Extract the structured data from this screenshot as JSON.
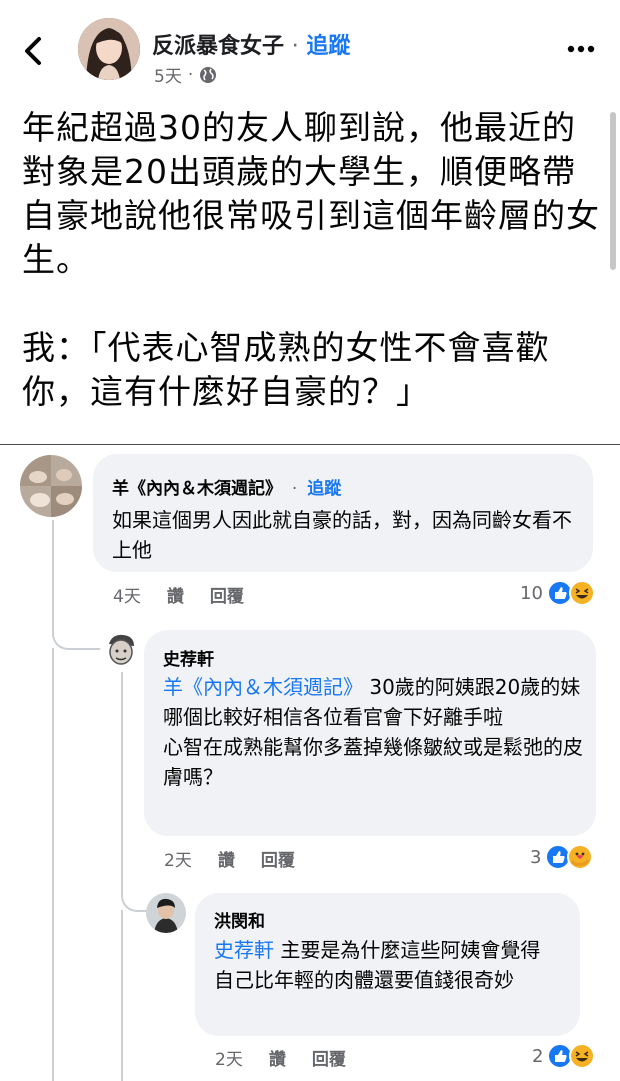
{
  "post": {
    "author": "反派暴食女子",
    "follow_label": "追蹤",
    "time": "5天",
    "separator": "·",
    "body": "年紀超過30的友人聊到說，他最近的對象是20出頭歲的大學生，順便略帶自豪地說他很常吸引到這個年齡層的女生。\n\n我：「代表心智成熟的女性不會喜歡你，這有什麼好自豪的？」",
    "icons": [
      "back-chevron-icon",
      "globe-icon",
      "more-options-icon"
    ]
  },
  "comments": [
    {
      "name": "羊《內內＆木須週記》",
      "follow_label": "追蹤",
      "text": "如果這個男人因此就自豪的話，對，因為同齡女看不上他",
      "time": "4天",
      "like_label": "讚",
      "reply_label": "回覆",
      "reaction_count": "10",
      "reactions": [
        "like",
        "haha"
      ]
    },
    {
      "name": "史荐軒",
      "mention": "羊《內內＆木須週記》",
      "text_after_mention": " 30歲的阿姨跟20歲的妹\n哪個比較好相信各位看官會下好離手啦\n心智在成熟能幫你多蓋掉幾條皺紋或是鬆弛的皮膚嗎？",
      "time": "2天",
      "like_label": "讚",
      "reply_label": "回覆",
      "reaction_count": "3",
      "reactions": [
        "like",
        "care"
      ]
    },
    {
      "name": "洪閔和",
      "mention": "史荐軒",
      "text_after_mention": " 主要是為什麼這些阿姨會覺得 自己比年輕的肉體還要值錢很奇妙",
      "time": "2天",
      "like_label": "讚",
      "reply_label": "回覆",
      "reaction_count": "2",
      "reactions": [
        "like",
        "haha"
      ]
    }
  ],
  "colors": {
    "link_blue": "#1877f2",
    "bubble_bg": "#f0f2f5",
    "meta_gray": "#65676b",
    "haha_yellow": "#f7b125"
  }
}
